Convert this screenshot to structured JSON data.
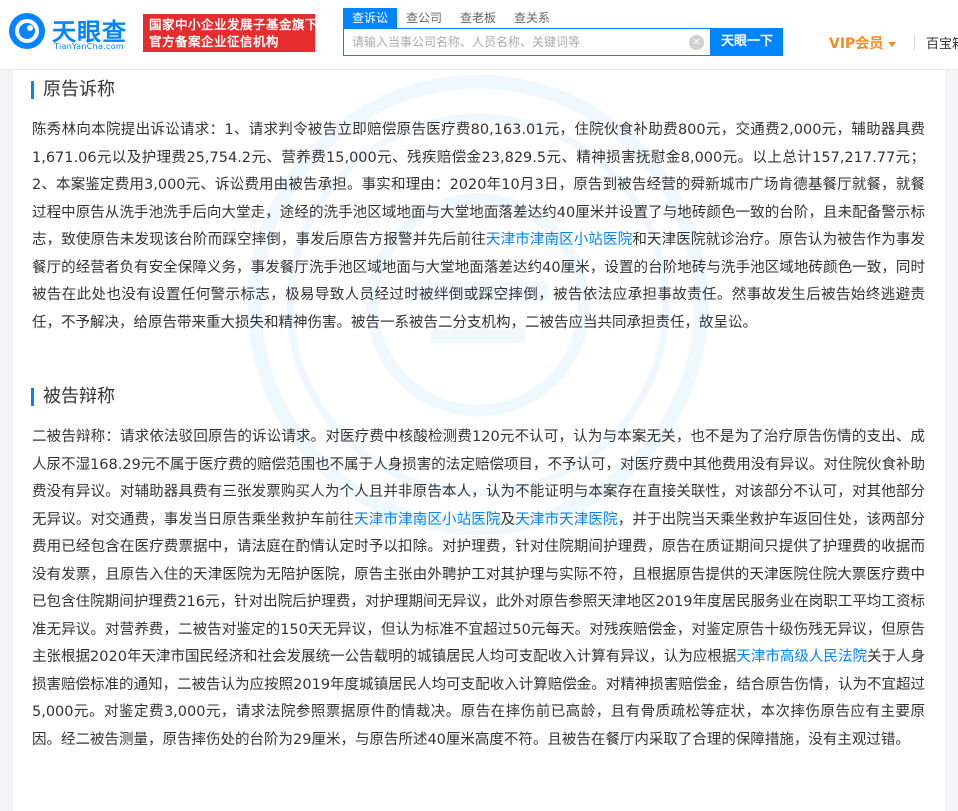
{
  "brand": {
    "name": "天眼查",
    "domain": "TianYanCha.com",
    "badge_line1": "国家中小企业发展子基金旗下",
    "badge_line2": "官方备案企业征信机构"
  },
  "search": {
    "tabs": [
      "查诉讼",
      "查公司",
      "查老板",
      "查关系"
    ],
    "active_tab": 0,
    "placeholder": "请输入当事公司名称、人员名称、关键词等",
    "button_label": "天眼一下"
  },
  "header_right": {
    "vip_label": "VIP会员",
    "partial_link": "百宝箱"
  },
  "colors": {
    "primary": "#0084ff",
    "badge_red": "#e62c2c",
    "vip_orange": "#f68b1f"
  },
  "sections": {
    "plaintiff": {
      "title": "原告诉称",
      "segments": [
        {
          "text": "陈秀林向本院提出诉讼请求：1、请求判令被告立即赔偿原告医疗费80,163.01元，住院伙食补助费800元，交通费2,000元，辅助器具费1,671.06元以及护理费25,754.2元、营养费15,000元、残疾赔偿金23,829.5元、精神损害抚慰金8,000元。以上总计157,217.77元；2、本案鉴定费用3,000元、诉讼费用由被告承担。事实和理由：2020年10月3日，原告到被告经营的舜新城市广场肯德基餐厅就餐，就餐过程中原告从洗手池洗手后向大堂走，途经的洗手池区域地面与大堂地面落差达约40厘米并设置了与地砖颜色一致的台阶，且未配备警示标志，致使原告未发现该台阶而踩空摔倒，事发后原告方报警并先后前往",
          "link": false
        },
        {
          "text": "天津市津南区小站医院",
          "link": true
        },
        {
          "text": "和天津医院就诊治疗。原告认为被告作为事发餐厅的经营者负有安全保障义务，事发餐厅洗手池区域地面与大堂地面落差达约40厘米，设置的台阶地砖与洗手池区域地砖颜色一致，同时被告在此处也没有设置任何警示标志，极易导致人员经过时被绊倒或踩空摔倒，被告依法应承担事故责任。然事故发生后被告始终逃避责任，不予解决，给原告带来重大损失和精神伤害。被告一系被告二分支机构，二被告应当共同承担责任，故呈讼。",
          "link": false
        }
      ]
    },
    "defendant": {
      "title": "被告辩称",
      "segments": [
        {
          "text": "二被告辩称：请求依法驳回原告的诉讼请求。对医疗费中核酸检测费120元不认可，认为与本案无关，也不是为了治疗原告伤情的支出、成人尿不湿168.29元不属于医疗费的赔偿范围也不属于人身损害的法定赔偿项目，不予认可，对医疗费中其他费用没有异议。对住院伙食补助费没有异议。对辅助器具费有三张发票购买人为个人且并非原告本人，认为不能证明与本案存在直接关联性，对该部分不认可，对其他部分无异议。对交通费，事发当日原告乘坐救护车前往",
          "link": false
        },
        {
          "text": "天津市津南区小站医院",
          "link": true
        },
        {
          "text": "及",
          "link": false
        },
        {
          "text": "天津市天津医院",
          "link": true
        },
        {
          "text": "，并于出院当天乘坐救护车返回住处，该两部分费用已经包含在医疗费票据中，请法庭在酌情认定时予以扣除。对护理费，针对住院期间护理费，原告在质证期间只提供了护理费的收据而没有发票，且原告入住的天津医院为无陪护医院，原告主张由外聘护工对其护理与实际不符，且根据原告提供的天津医院住院大票医疗费中已包含住院期间护理费216元，针对出院后护理费，对护理期间无异议，此外对原告参照天津地区2019年度居民服务业在岗职工平均工资标准无异议。对营养费，二被告对鉴定的150天无异议，但认为标准不宜超过50元每天。对残疾赔偿金，对鉴定原告十级伤残无异议，但原告主张根据2020年天津市国民经济和社会发展统一公告载明的城镇居民人均可支配收入计算有异议，认为应根据",
          "link": false
        },
        {
          "text": "天津市高级人民法院",
          "link": true
        },
        {
          "text": "关于人身损害赔偿标准的通知，二被告认为应按照2019年度城镇居民人均可支配收入计算赔偿金。对精神损害赔偿金，结合原告伤情，认为不宜超过5,000元。对鉴定费3,000元，请求法院参照票据原件酌情裁决。原告在摔伤前已高龄，且有骨质疏松等症状，本次摔伤原告应有主要原因。经二被告测量，原告摔伤处的台阶为29厘米，与原告所述40厘米高度不符。且被告在餐厅内采取了合理的保障措施，没有主观过错。",
          "link": false
        }
      ]
    }
  }
}
